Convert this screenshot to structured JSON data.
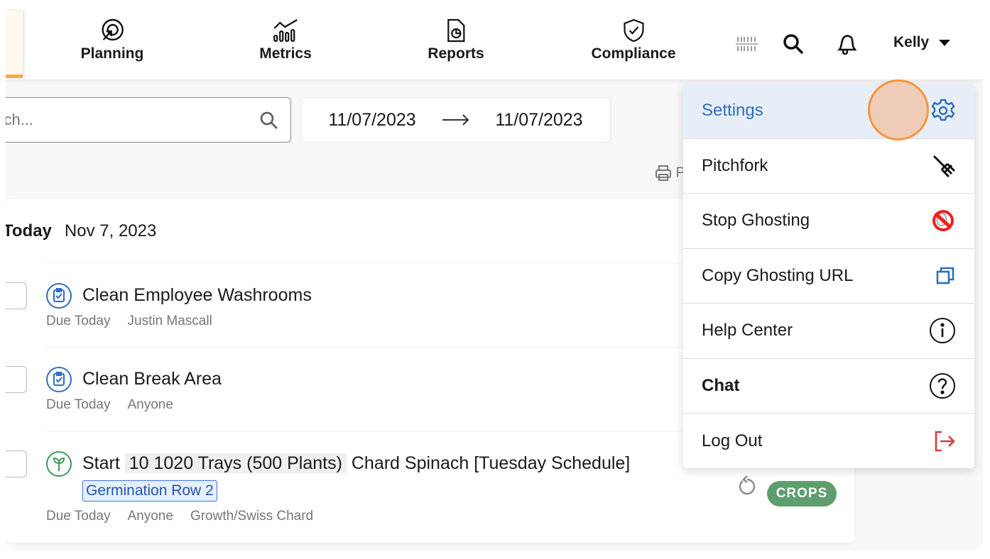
{
  "nav": {
    "items": [
      {
        "label": "Planning",
        "icon": "target-icon"
      },
      {
        "label": "Metrics",
        "icon": "metrics-icon"
      },
      {
        "label": "Reports",
        "icon": "report-icon"
      },
      {
        "label": "Compliance",
        "icon": "shield-check-icon"
      }
    ],
    "user": "Kelly"
  },
  "toolbar": {
    "search_placeholder": "Search...",
    "date_from": "11/07/2023",
    "date_to": "11/07/2023",
    "print_label": "P"
  },
  "day": {
    "label": "Today",
    "date": "Nov 7, 2023"
  },
  "tasks": [
    {
      "title": "Clean Employee Washrooms",
      "due": "Due Today",
      "assignee": "Justin Mascall"
    },
    {
      "title": "Clean Break Area",
      "due": "Due Today",
      "assignee": "Anyone"
    },
    {
      "title_prefix": "Start",
      "title_highlight": "10 1020 Trays (500 Plants)",
      "title_suffix": "Chard Spinach [Tuesday Schedule]",
      "location": "Germination Row 2",
      "due": "Due Today",
      "assignee": "Anyone",
      "category": "Growth/Swiss Chard",
      "badge": "CROPS"
    }
  ],
  "menu": {
    "items": [
      {
        "label": "Settings",
        "icon": "gear-icon"
      },
      {
        "label": "Pitchfork",
        "icon": "pitchfork-icon"
      },
      {
        "label": "Stop Ghosting",
        "icon": "ghostbusters-icon"
      },
      {
        "label": "Copy Ghosting URL",
        "icon": "copy-icon"
      },
      {
        "label": "Help Center",
        "icon": "info-icon"
      },
      {
        "label": "Chat",
        "icon": "question-icon"
      },
      {
        "label": "Log Out",
        "icon": "logout-icon"
      }
    ]
  },
  "colors": {
    "accent": "#2c6fbe",
    "crops": "#5e9e6e",
    "logout": "#d63b3b",
    "brand": "#f6a94b"
  }
}
